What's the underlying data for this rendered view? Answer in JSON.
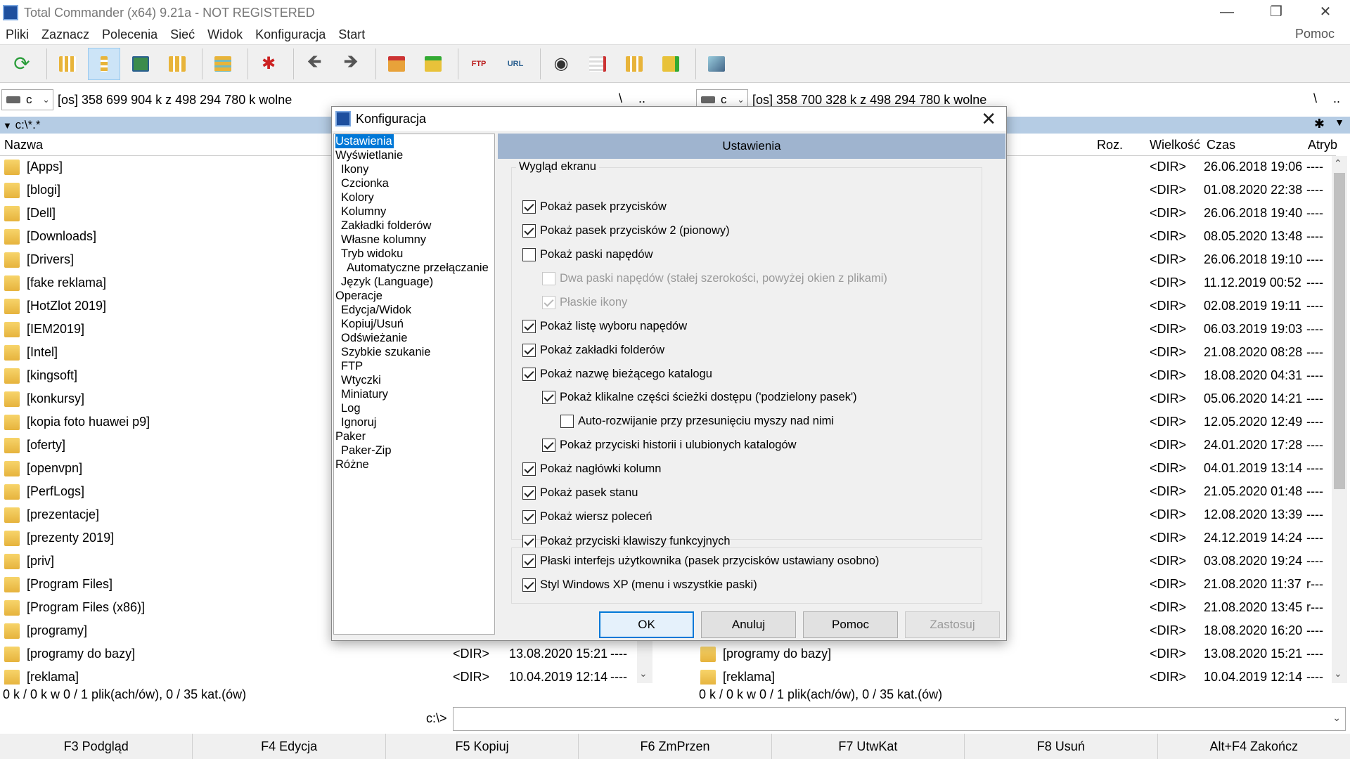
{
  "window": {
    "title": "Total Commander (x64) 9.21a - NOT REGISTERED",
    "help": "Pomoc"
  },
  "menu": [
    "Pliki",
    "Zaznacz",
    "Polecenia",
    "Sieć",
    "Widok",
    "Konfiguracja",
    "Start"
  ],
  "toolbar_icons": [
    "refresh-icon",
    "brief-view-icon",
    "detailed-view-icon",
    "thumbnails-view-icon",
    "tree-view-icon",
    "tree-panel-icon",
    "invert-selection-icon",
    "back-icon",
    "forward-icon",
    "pack-icon",
    "unpack-icon",
    "ftp-connect-icon",
    "url-ftp-icon",
    "find-files-icon",
    "multi-rename-icon",
    "compare-dirs-icon",
    "sync-dirs-icon",
    "notepad-icon"
  ],
  "left": {
    "drive": "c",
    "free": "[os]  358 699 904 k z 498 294 780 k wolne",
    "path": "c:\\*.*",
    "col_name": "Nazwa",
    "status": "0 k / 0 k w 0 / 1 plik(ach/ów), 0 / 35 kat.(ów)",
    "root": "\\",
    "up": ".."
  },
  "right": {
    "drive": "c",
    "free": "[os]  358 700 328 k z 498 294 780 k wolne",
    "col_ext": "Roz.",
    "col_size": "Wielkość",
    "col_date": "Czas",
    "col_attr": "Atryb",
    "status": "0 k / 0 k w 0 / 1 plik(ach/ów), 0 / 35 kat.(ów)",
    "root": "\\",
    "up": "..",
    "star": "✱"
  },
  "left_files": [
    {
      "name": "[Apps]"
    },
    {
      "name": "[blogi]"
    },
    {
      "name": "[Dell]"
    },
    {
      "name": "[Downloads]"
    },
    {
      "name": "[Drivers]"
    },
    {
      "name": "[fake reklama]"
    },
    {
      "name": "[HotZlot 2019]"
    },
    {
      "name": "[IEM2019]"
    },
    {
      "name": "[Intel]"
    },
    {
      "name": "[kingsoft]"
    },
    {
      "name": "[konkursy]"
    },
    {
      "name": "[kopia foto huawei p9]"
    },
    {
      "name": "[oferty]"
    },
    {
      "name": "[openvpn]"
    },
    {
      "name": "[PerfLogs]"
    },
    {
      "name": "[prezentacje]"
    },
    {
      "name": "[prezenty 2019]"
    },
    {
      "name": "[priv]"
    },
    {
      "name": "[Program Files]"
    },
    {
      "name": "[Program Files (x86)]"
    },
    {
      "name": "[programy]"
    },
    {
      "name": "[programy do bazy]",
      "size": "<DIR>",
      "date": "13.08.2020 15:21",
      "attr": "----"
    },
    {
      "name": "[reklama]",
      "size": "<DIR>",
      "date": "10.04.2019 12:14",
      "attr": "----"
    }
  ],
  "right_files": [
    {
      "size": "<DIR>",
      "date": "26.06.2018 19:06",
      "attr": "----"
    },
    {
      "size": "<DIR>",
      "date": "01.08.2020 22:38",
      "attr": "----"
    },
    {
      "size": "<DIR>",
      "date": "26.06.2018 19:40",
      "attr": "----"
    },
    {
      "size": "<DIR>",
      "date": "08.05.2020 13:48",
      "attr": "----"
    },
    {
      "size": "<DIR>",
      "date": "26.06.2018 19:10",
      "attr": "----"
    },
    {
      "size": "<DIR>",
      "date": "11.12.2019 00:52",
      "attr": "----"
    },
    {
      "size": "<DIR>",
      "date": "02.08.2019 19:11",
      "attr": "----"
    },
    {
      "size": "<DIR>",
      "date": "06.03.2019 19:03",
      "attr": "----"
    },
    {
      "size": "<DIR>",
      "date": "21.08.2020 08:28",
      "attr": "----"
    },
    {
      "size": "<DIR>",
      "date": "18.08.2020 04:31",
      "attr": "----"
    },
    {
      "size": "<DIR>",
      "date": "05.06.2020 14:21",
      "attr": "----"
    },
    {
      "size": "<DIR>",
      "date": "12.05.2020 12:49",
      "attr": "----"
    },
    {
      "size": "<DIR>",
      "date": "24.01.2020 17:28",
      "attr": "----"
    },
    {
      "size": "<DIR>",
      "date": "04.01.2019 13:14",
      "attr": "----"
    },
    {
      "size": "<DIR>",
      "date": "21.05.2020 01:48",
      "attr": "----"
    },
    {
      "size": "<DIR>",
      "date": "12.08.2020 13:39",
      "attr": "----"
    },
    {
      "size": "<DIR>",
      "date": "24.12.2019 14:24",
      "attr": "----"
    },
    {
      "size": "<DIR>",
      "date": "03.08.2020 19:24",
      "attr": "----"
    },
    {
      "size": "<DIR>",
      "date": "21.08.2020 11:37",
      "attr": "r---"
    },
    {
      "size": "<DIR>",
      "date": "21.08.2020 13:45",
      "attr": "r---"
    },
    {
      "size": "<DIR>",
      "date": "18.08.2020 16:20",
      "attr": "----"
    },
    {
      "name": "[programy do bazy]",
      "size": "<DIR>",
      "date": "13.08.2020 15:21",
      "attr": "----"
    },
    {
      "name": "[reklama]",
      "size": "<DIR>",
      "date": "10.04.2019 12:14",
      "attr": "----"
    }
  ],
  "cmdline": {
    "prompt": "c:\\>",
    "value": ""
  },
  "fkeys": [
    "F3 Podgląd",
    "F4 Edycja",
    "F5 Kopiuj",
    "F6 ZmPrzen",
    "F7 UtwKat",
    "F8 Usuń",
    "Alt+F4 Zakończ"
  ],
  "dialog": {
    "title": "Konfiguracja",
    "close": "✕",
    "header": "Ustawienia",
    "group_label": "Wygląd ekranu",
    "tree": [
      {
        "label": "Ustawienia",
        "level": 0,
        "selected": true
      },
      {
        "label": "Wyświetlanie",
        "level": 0
      },
      {
        "label": "Ikony",
        "level": 1
      },
      {
        "label": "Czcionka",
        "level": 1
      },
      {
        "label": "Kolory",
        "level": 1
      },
      {
        "label": "Kolumny",
        "level": 1
      },
      {
        "label": "Zakładki folderów",
        "level": 1
      },
      {
        "label": "Własne kolumny",
        "level": 1
      },
      {
        "label": "Tryb widoku",
        "level": 1
      },
      {
        "label": "Automatyczne przełączanie",
        "level": 2
      },
      {
        "label": "Język (Language)",
        "level": 1
      },
      {
        "label": "Operacje",
        "level": 0
      },
      {
        "label": "Edycja/Widok",
        "level": 1
      },
      {
        "label": "Kopiuj/Usuń",
        "level": 1
      },
      {
        "label": "Odświeżanie",
        "level": 1
      },
      {
        "label": "Szybkie szukanie",
        "level": 1
      },
      {
        "label": "FTP",
        "level": 1
      },
      {
        "label": "Wtyczki",
        "level": 1
      },
      {
        "label": "Miniatury",
        "level": 1
      },
      {
        "label": "Log",
        "level": 1
      },
      {
        "label": "Ignoruj",
        "level": 1
      },
      {
        "label": "Paker",
        "level": 0
      },
      {
        "label": "Paker-Zip",
        "level": 1
      },
      {
        "label": "Różne",
        "level": 0
      }
    ],
    "options": [
      {
        "label": "Pokaż pasek przycisków",
        "checked": true,
        "indent": 0
      },
      {
        "label": "Pokaż pasek przycisków 2 (pionowy)",
        "checked": true,
        "indent": 0
      },
      {
        "label": "Pokaż paski napędów",
        "checked": false,
        "indent": 0
      },
      {
        "label": "Dwa paski napędów (stałej szerokości, powyżej okien z plikami)",
        "checked": false,
        "indent": 1,
        "disabled": true
      },
      {
        "label": "Płaskie ikony",
        "checked": true,
        "indent": 1,
        "disabled": true
      },
      {
        "label": "Pokaż listę wyboru napędów",
        "checked": true,
        "indent": 0
      },
      {
        "label": "Pokaż zakładki folderów",
        "checked": true,
        "indent": 0
      },
      {
        "label": "Pokaż nazwę bieżącego katalogu",
        "checked": true,
        "indent": 0
      },
      {
        "label": "Pokaż klikalne części ścieżki dostępu ('podzielony pasek')",
        "checked": true,
        "indent": 1
      },
      {
        "label": "Auto-rozwijanie przy przesunięciu myszy nad nimi",
        "checked": false,
        "indent": 2
      },
      {
        "label": "Pokaż przyciski historii i ulubionych katalogów",
        "checked": true,
        "indent": 1
      },
      {
        "label": "Pokaż nagłówki kolumn",
        "checked": true,
        "indent": 0
      },
      {
        "label": "Pokaż pasek stanu",
        "checked": true,
        "indent": 0
      },
      {
        "label": "Pokaż wiersz poleceń",
        "checked": true,
        "indent": 0
      },
      {
        "label": "Pokaż przyciski klawiszy funkcyjnych",
        "checked": true,
        "indent": 0
      }
    ],
    "options2": [
      {
        "label": "Płaski interfejs użytkownika (pasek przycisków ustawiany osobno)",
        "checked": true
      },
      {
        "label": "Styl Windows XP (menu i wszystkie paski)",
        "checked": true
      }
    ],
    "buttons": {
      "ok": "OK",
      "cancel": "Anuluj",
      "help": "Pomoc",
      "apply": "Zastosuj"
    }
  }
}
